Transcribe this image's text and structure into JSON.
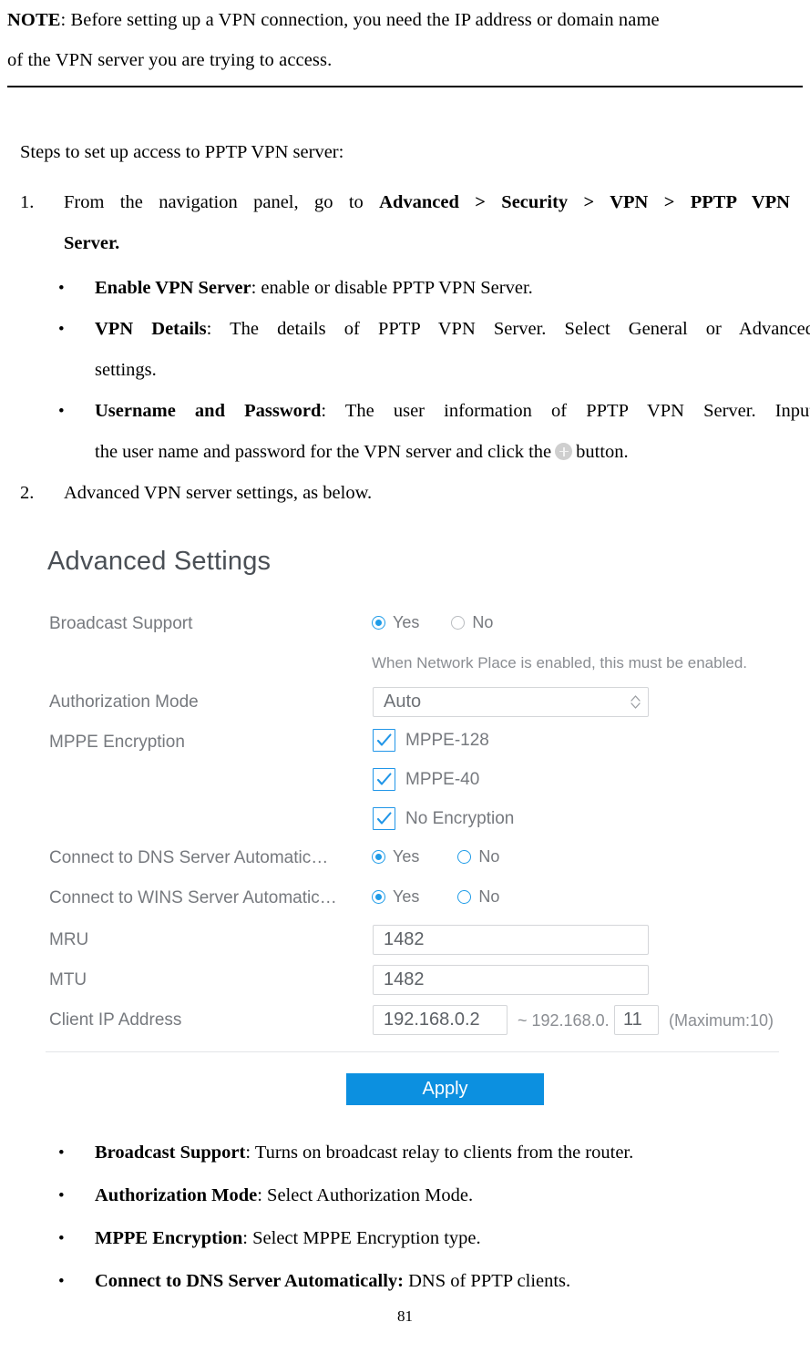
{
  "note": {
    "label": "NOTE",
    "line1_rest": ": Before setting up a VPN connection, you need the IP address or domain name",
    "line2": "of the VPN server you are trying to access."
  },
  "doc": {
    "intro": "Steps to set up access to PPTP VPN server:",
    "step1": {
      "marker": "1.",
      "line1_plain": "From the navigation panel, go to ",
      "line1_bold": "Advanced > Security > VPN > PPTP VPN",
      "line2_bold": "Server."
    },
    "bullets_top": [
      {
        "marker": "•",
        "bold": "Enable VPN Server",
        "rest": ": enable or disable PPTP VPN Server."
      },
      {
        "marker": "•",
        "bold": "VPN Details",
        "rest": ": The details of PPTP VPN Server. Select General or Advanced",
        "line2": "settings."
      },
      {
        "marker": "•",
        "bold": "Username and Password",
        "rest": ": The user information of PPTP VPN Server. Input",
        "line2_pre": "the user name and password for the VPN server and click the",
        "line2_post": "button.",
        "icon": "plus-circle-icon"
      }
    ],
    "step2": {
      "marker": "2.",
      "text": "Advanced VPN server settings, as below."
    },
    "bullets_bottom": [
      {
        "marker": "•",
        "bold": "Broadcast Support",
        "rest": ": Turns on broadcast relay to clients from the router."
      },
      {
        "marker": "•",
        "bold": "Authorization Mode",
        "rest": ": Select Authorization Mode."
      },
      {
        "marker": "•",
        "bold": "MPPE Encryption",
        "rest": ": Select MPPE Encryption type."
      },
      {
        "marker": "•",
        "bold": "Connect to DNS Server Automatically:",
        "rest": " DNS of PPTP clients."
      }
    ],
    "page_number": "81"
  },
  "panel": {
    "title": "Advanced Settings",
    "accent_color": "#1f9ce8",
    "apply_color": "#0c90e0",
    "broadcast": {
      "label": "Broadcast Support",
      "yes_label": "Yes",
      "no_label": "No",
      "selected": "Yes",
      "hint": "When Network Place is enabled, this must be enabled."
    },
    "auth_mode": {
      "label": "Authorization Mode",
      "value": "Auto"
    },
    "mppe": {
      "label": "MPPE Encryption",
      "options": [
        {
          "label": "MPPE-128",
          "checked": true
        },
        {
          "label": "MPPE-40",
          "checked": true
        },
        {
          "label": "No Encryption",
          "checked": true
        }
      ]
    },
    "dns": {
      "label": "Connect to DNS Server Automatic…",
      "yes_label": "Yes",
      "no_label": "No",
      "selected": "Yes"
    },
    "wins": {
      "label": "Connect to WINS Server Automatic…",
      "yes_label": "Yes",
      "no_label": "No",
      "selected": "Yes"
    },
    "mru": {
      "label": "MRU",
      "value": "1482"
    },
    "mtu": {
      "label": "MTU",
      "value": "1482"
    },
    "client_ip": {
      "label": "Client IP Address",
      "start_value": "192.168.0.2",
      "separator": "~ 192.168.0.",
      "end_value": "11",
      "max_text": "(Maximum:10)"
    },
    "apply_label": "Apply"
  }
}
